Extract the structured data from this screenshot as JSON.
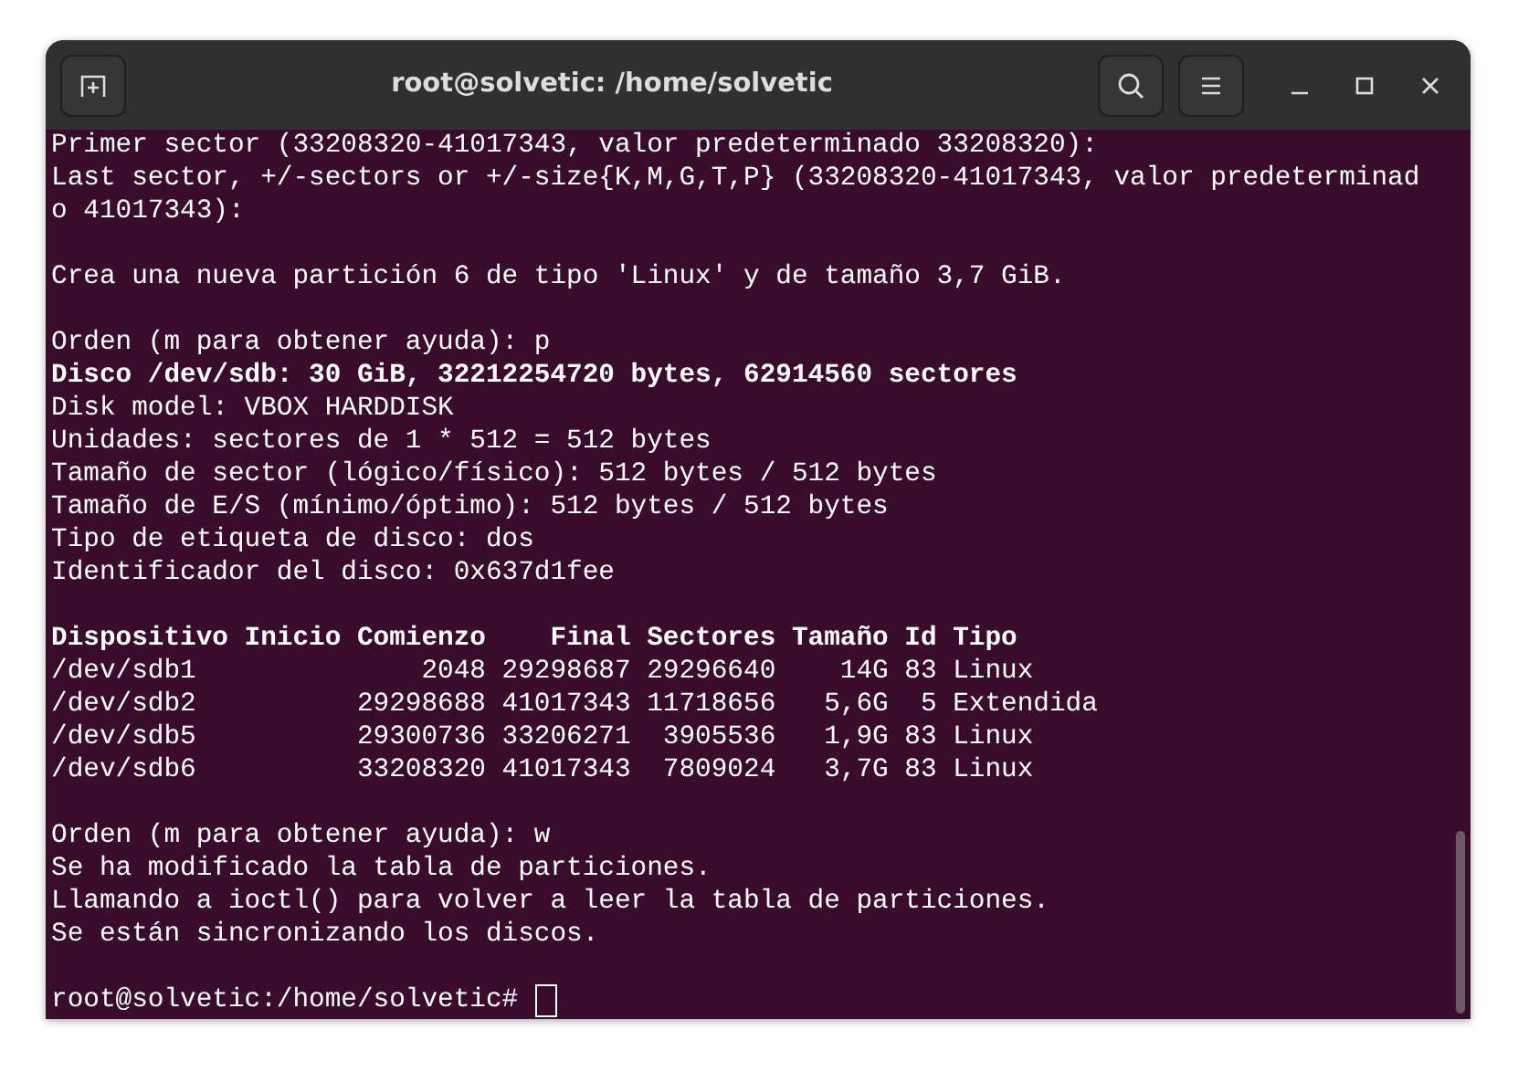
{
  "window": {
    "title": "root@solvetic: /home/solvetic"
  },
  "terminal": {
    "lines": [
      {
        "kind": "text",
        "text": "Primer sector (33208320-41017343, valor predeterminado 33208320):"
      },
      {
        "kind": "text",
        "text": "Last sector, +/-sectors or +/-size{K,M,G,T,P} (33208320-41017343, valor predeterminad"
      },
      {
        "kind": "text",
        "text": "o 41017343):"
      },
      {
        "kind": "blank"
      },
      {
        "kind": "text",
        "text": "Crea una nueva partición 6 de tipo 'Linux' y de tamaño 3,7 GiB."
      },
      {
        "kind": "blank"
      },
      {
        "kind": "text",
        "text": "Orden (m para obtener ayuda): p"
      },
      {
        "kind": "bold",
        "text": "Disco /dev/sdb: 30 GiB, 32212254720 bytes, 62914560 sectores"
      },
      {
        "kind": "text",
        "text": "Disk model: VBOX HARDDISK"
      },
      {
        "kind": "text",
        "text": "Unidades: sectores de 1 * 512 = 512 bytes"
      },
      {
        "kind": "text",
        "text": "Tamaño de sector (lógico/físico): 512 bytes / 512 bytes"
      },
      {
        "kind": "text",
        "text": "Tamaño de E/S (mínimo/óptimo): 512 bytes / 512 bytes"
      },
      {
        "kind": "text",
        "text": "Tipo de etiqueta de disco: dos"
      },
      {
        "kind": "text",
        "text": "Identificador del disco: 0x637d1fee"
      },
      {
        "kind": "blank"
      },
      {
        "kind": "bold",
        "text": "Dispositivo Inicio Comienzo    Final Sectores Tamaño Id Tipo"
      },
      {
        "kind": "text",
        "text": "/dev/sdb1              2048 29298687 29296640    14G 83 Linux"
      },
      {
        "kind": "text",
        "text": "/dev/sdb2          29298688 41017343 11718656   5,6G  5 Extendida"
      },
      {
        "kind": "text",
        "text": "/dev/sdb5          29300736 33206271  3905536   1,9G 83 Linux"
      },
      {
        "kind": "text",
        "text": "/dev/sdb6          33208320 41017343  7809024   3,7G 83 Linux"
      },
      {
        "kind": "blank"
      },
      {
        "kind": "text",
        "text": "Orden (m para obtener ayuda): w"
      },
      {
        "kind": "text",
        "text": "Se ha modificado la tabla de particiones."
      },
      {
        "kind": "text",
        "text": "Llamando a ioctl() para volver a leer la tabla de particiones."
      },
      {
        "kind": "text",
        "text": "Se están sincronizando los discos."
      },
      {
        "kind": "blank"
      },
      {
        "kind": "prompt",
        "text": "root@solvetic:/home/solvetic#"
      }
    ]
  }
}
